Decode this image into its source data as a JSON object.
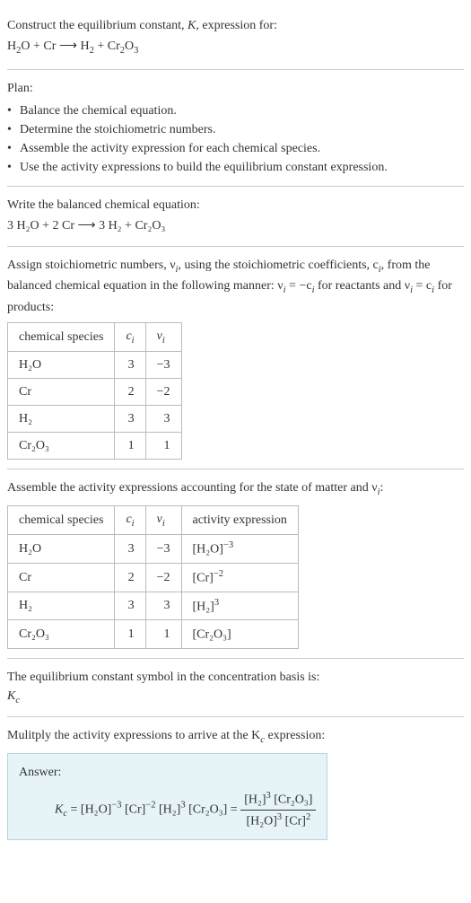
{
  "header": {
    "prompt": "Construct the equilibrium constant, K, expression for:",
    "equation_lhs1": "H",
    "equation_lhs1_sub": "2",
    "equation_lhs2": "O + Cr",
    "arrow": " ⟶ ",
    "equation_rhs1": "H",
    "equation_rhs1_sub": "2",
    "equation_rhs2": " + Cr",
    "equation_rhs2_sub": "2",
    "equation_rhs3": "O",
    "equation_rhs3_sub": "3"
  },
  "plan": {
    "title": "Plan:",
    "items": [
      "Balance the chemical equation.",
      "Determine the stoichiometric numbers.",
      "Assemble the activity expression for each chemical species.",
      "Use the activity expressions to build the equilibrium constant expression."
    ]
  },
  "balanced": {
    "title": "Write the balanced chemical equation:",
    "eq": "3 H₂O + 2 Cr ⟶ 3 H₂ + Cr₂O₃"
  },
  "stoich": {
    "intro1": "Assign stoichiometric numbers, ν",
    "intro1_sub": "i",
    "intro2": ", using the stoichiometric coefficients, c",
    "intro2_sub": "i",
    "intro3": ", from the balanced chemical equation in the following manner: ν",
    "intro3_sub": "i",
    "intro4": " = −c",
    "intro4_sub": "i",
    "intro5": " for reactants and ν",
    "intro5_sub": "i",
    "intro6": " = c",
    "intro6_sub": "i",
    "intro7": " for products:",
    "headers": {
      "species": "chemical species",
      "ci": "c",
      "ci_sub": "i",
      "vi": "ν",
      "vi_sub": "i"
    },
    "rows": [
      {
        "species": "H₂O",
        "ci": "3",
        "vi": "−3"
      },
      {
        "species": "Cr",
        "ci": "2",
        "vi": "−2"
      },
      {
        "species": "H₂",
        "ci": "3",
        "vi": "3"
      },
      {
        "species": "Cr₂O₃",
        "ci": "1",
        "vi": "1"
      }
    ]
  },
  "activity": {
    "intro": "Assemble the activity expressions accounting for the state of matter and ν",
    "intro_sub": "i",
    "intro_end": ":",
    "headers": {
      "species": "chemical species",
      "ci": "c",
      "ci_sub": "i",
      "vi": "ν",
      "vi_sub": "i",
      "act": "activity expression"
    },
    "rows": [
      {
        "species": "H₂O",
        "ci": "3",
        "vi": "−3",
        "act_base": "[H₂O]",
        "act_exp": "−3"
      },
      {
        "species": "Cr",
        "ci": "2",
        "vi": "−2",
        "act_base": "[Cr]",
        "act_exp": "−2"
      },
      {
        "species": "H₂",
        "ci": "3",
        "vi": "3",
        "act_base": "[H₂]",
        "act_exp": "3"
      },
      {
        "species": "Cr₂O₃",
        "ci": "1",
        "vi": "1",
        "act_base": "[Cr₂O₃]",
        "act_exp": ""
      }
    ]
  },
  "kc_symbol": {
    "line1": "The equilibrium constant symbol in the concentration basis is:",
    "symbol": "K",
    "symbol_sub": "c"
  },
  "multiply": {
    "line": "Mulitply the activity expressions to arrive at the K",
    "line_sub": "c",
    "line_end": " expression:"
  },
  "answer": {
    "label": "Answer:",
    "lhs_sym": "K",
    "lhs_sub": "c",
    "p1_base": " = [H₂O]",
    "p1_exp": "−3",
    "p2_base": " [Cr]",
    "p2_exp": "−2",
    "p3_base": " [H₂]",
    "p3_exp": "3",
    "p4": " [Cr₂O₃] = ",
    "num_a": "[H₂]",
    "num_a_exp": "3",
    "num_b": " [Cr₂O₃]",
    "den_a": "[H₂O]",
    "den_a_exp": "3",
    "den_b": " [Cr]",
    "den_b_exp": "2"
  },
  "bullet": "•"
}
